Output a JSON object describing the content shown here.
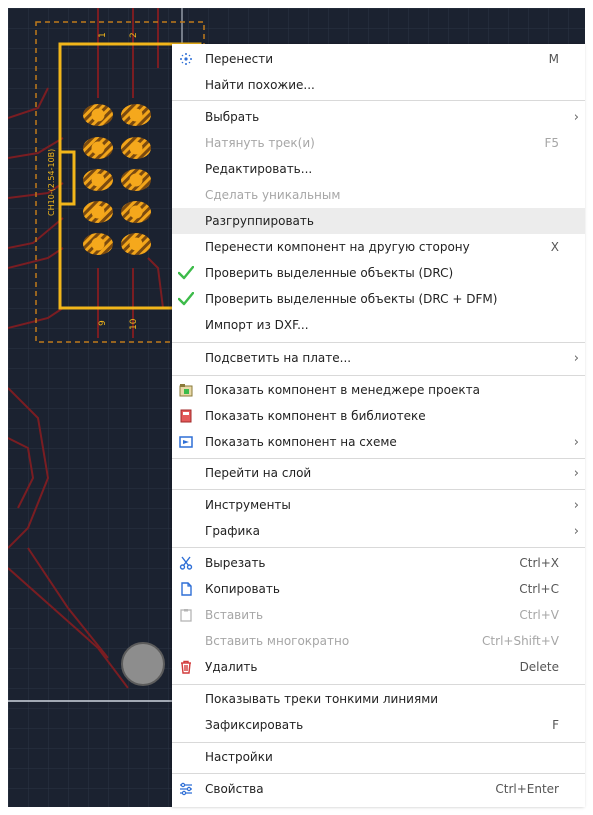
{
  "pcb": {
    "pin_top": [
      "1",
      "2"
    ],
    "pin_bottom": [
      "9",
      "10"
    ],
    "designator": "CH10-(2.54-10B)"
  },
  "menu": {
    "move": {
      "label": "Перенести",
      "shortcut": "M",
      "icon": "move-icon"
    },
    "find_similar": {
      "label": "Найти похожие..."
    },
    "select": {
      "label": "Выбрать"
    },
    "stretch_track": {
      "label": "Натянуть трек(и)",
      "shortcut": "F5"
    },
    "edit": {
      "label": "Редактировать..."
    },
    "make_unique": {
      "label": "Сделать уникальным"
    },
    "ungroup": {
      "label": "Разгруппировать"
    },
    "flip_side": {
      "label": "Перенести компонент на другую сторону",
      "shortcut": "X"
    },
    "drc": {
      "label": "Проверить выделенные объекты (DRC)",
      "icon": "check-icon"
    },
    "drc_dfm": {
      "label": "Проверить выделенные объекты (DRC + DFM)",
      "icon": "check-icon"
    },
    "import_dxf": {
      "label": "Импорт из DXF..."
    },
    "highlight_board": {
      "label": "Подсветить на плате..."
    },
    "show_project": {
      "label": "Показать компонент в менеджере проекта",
      "icon": "project-icon"
    },
    "show_library": {
      "label": "Показать компонент в библиотеке",
      "icon": "library-icon"
    },
    "show_schematic": {
      "label": "Показать компонент на схеме",
      "icon": "schematic-icon"
    },
    "goto_layer": {
      "label": "Перейти на слой"
    },
    "tools": {
      "label": "Инструменты"
    },
    "graphics": {
      "label": "Графика"
    },
    "cut": {
      "label": "Вырезать",
      "shortcut": "Ctrl+X",
      "icon": "scissors-icon"
    },
    "copy": {
      "label": "Копировать",
      "shortcut": "Ctrl+C",
      "icon": "copy-icon"
    },
    "paste": {
      "label": "Вставить",
      "shortcut": "Ctrl+V",
      "icon": "clipboard-icon"
    },
    "paste_multiple": {
      "label": "Вставить многократно",
      "shortcut": "Ctrl+Shift+V"
    },
    "delete": {
      "label": "Удалить",
      "shortcut": "Delete",
      "icon": "trash-icon"
    },
    "thin_tracks": {
      "label": "Показывать треки тонкими линиями"
    },
    "lock": {
      "label": "Зафиксировать",
      "shortcut": "F"
    },
    "settings": {
      "label": "Настройки"
    },
    "properties": {
      "label": "Свойства",
      "shortcut": "Ctrl+Enter",
      "icon": "properties-icon"
    }
  },
  "colors": {
    "canvas_bg": "#1b2230",
    "trace": "#7a1d22",
    "outline": "#f2b61a",
    "pad": "#f2a51a",
    "check": "#3dbb4a",
    "delete": "#d23a3a",
    "accent_icon": "#2f6fd6"
  }
}
